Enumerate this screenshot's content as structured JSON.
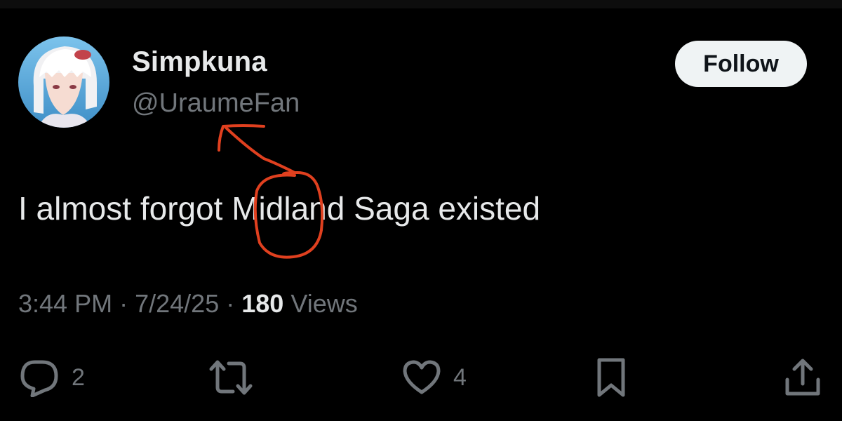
{
  "user": {
    "display_name": "Simpkuna",
    "handle": "@UraumeFan",
    "follow_label": "Follow"
  },
  "tweet": {
    "text": "I almost forgot Midland Saga existed"
  },
  "meta": {
    "time": "3:44 PM",
    "separator": "·",
    "date": "7/24/25",
    "views_count": "180",
    "views_label": "Views"
  },
  "actions": {
    "reply_count": "2",
    "like_count": "4"
  },
  "icons": {
    "reply": "reply-icon",
    "retweet": "retweet-icon",
    "like": "heart-icon",
    "bookmark": "bookmark-icon",
    "share": "share-icon"
  },
  "colors": {
    "background": "#000000",
    "text": "#e7e9ea",
    "muted": "#71767b",
    "follow_bg": "#eff3f4",
    "annotation": "#e0401f"
  }
}
